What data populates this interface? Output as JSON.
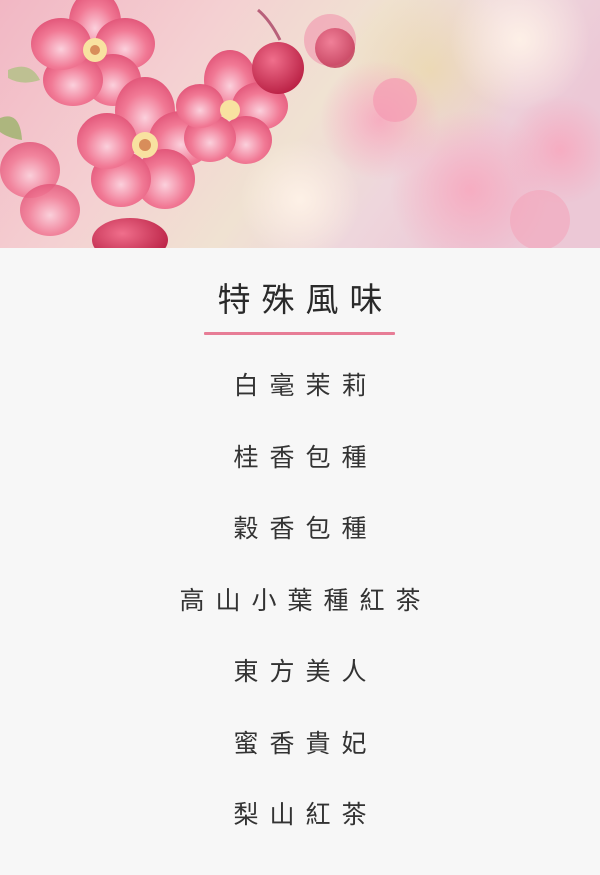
{
  "section": {
    "title": "特殊風味",
    "accent_color": "#e77d96"
  },
  "menu": {
    "items": [
      {
        "label": "白毫茉莉"
      },
      {
        "label": "桂香包種"
      },
      {
        "label": "穀香包種"
      },
      {
        "label": "高山小葉種紅茶"
      },
      {
        "label": "東方美人"
      },
      {
        "label": "蜜香貴妃"
      },
      {
        "label": "梨山紅茶"
      }
    ]
  },
  "hero": {
    "image_subject": "pink-blossom-photo"
  }
}
